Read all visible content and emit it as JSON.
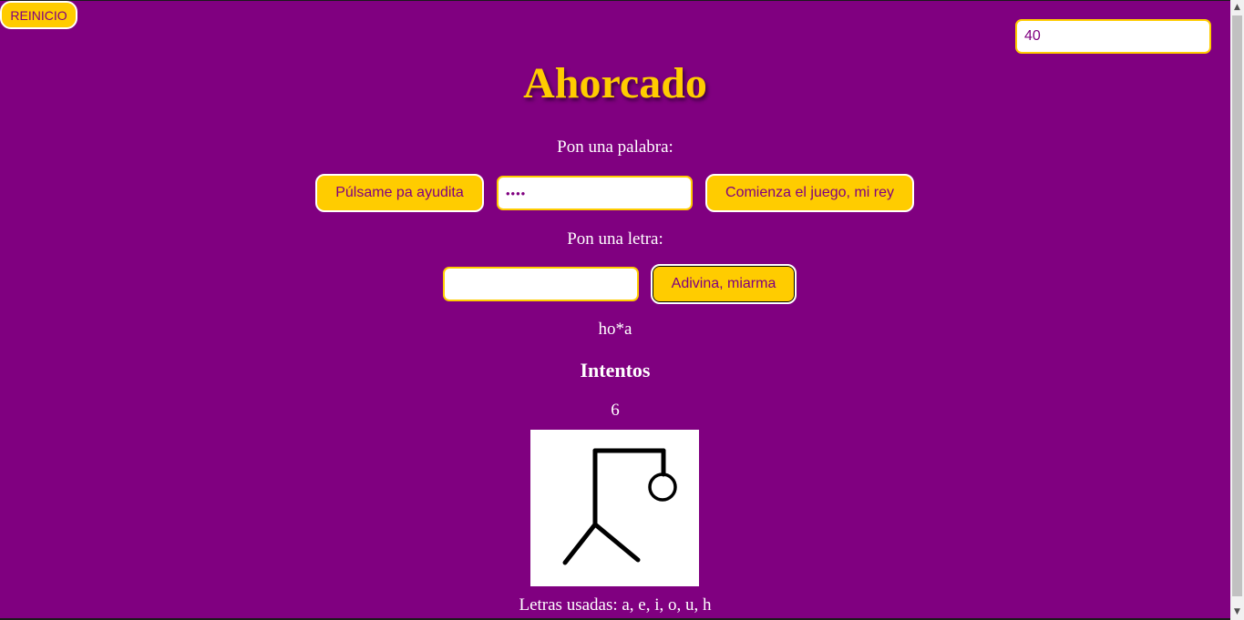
{
  "header": {
    "reset_label": "REINICIO",
    "counter_value": "40",
    "title": "Ahorcado"
  },
  "word_section": {
    "label": "Pon una palabra:",
    "help_button": "Púlsame pa ayudita",
    "word_input_value": "••••",
    "start_button": "Comienza el juego, mi rey"
  },
  "letter_section": {
    "label": "Pon una letra:",
    "letter_input_value": "",
    "guess_button": "Adivina, miarma"
  },
  "game": {
    "masked_word": "ho*a",
    "attempts_heading": "Intentos",
    "attempts_count": "6",
    "used_letters": "Letras usadas: a, e, i, o, u, h"
  },
  "colors": {
    "background": "#800080",
    "accent": "#ffcc00",
    "text": "#ffffff"
  },
  "icons": {
    "hangman": "hangman-drawing-icon",
    "scroll_up": "scroll-up-arrow-icon",
    "scroll_down": "scroll-down-arrow-icon"
  }
}
